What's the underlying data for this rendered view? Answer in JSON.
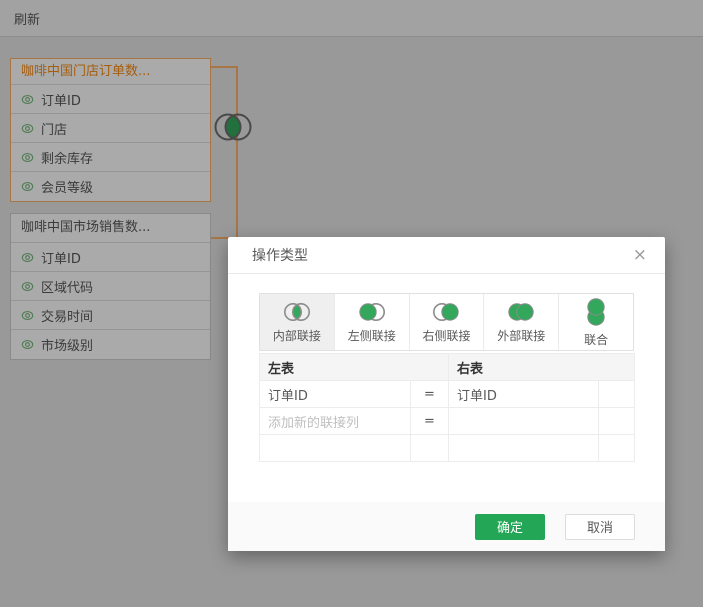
{
  "topbar": {
    "refresh_label": "刷新"
  },
  "canvas": {
    "tables": [
      {
        "name": "咖啡中国门店订单数...",
        "selected": true,
        "fields": [
          "订单ID",
          "门店",
          "剩余库存",
          "会员等级"
        ]
      },
      {
        "name": "咖啡中国市场销售数...",
        "selected": false,
        "fields": [
          "订单ID",
          "区域代码",
          "交易时间",
          "市场级别"
        ]
      }
    ],
    "join_node": "inner-join"
  },
  "dialog": {
    "title": "操作类型",
    "close_icon": "×",
    "join_types": [
      {
        "label": "内部联接",
        "selected": true
      },
      {
        "label": "左侧联接",
        "selected": false
      },
      {
        "label": "右侧联接",
        "selected": false
      },
      {
        "label": "外部联接",
        "selected": false
      },
      {
        "label": "联合",
        "selected": false
      }
    ],
    "mapping": {
      "left_header": "左表",
      "right_header": "右表",
      "rows": [
        {
          "left": "订单ID",
          "op": "=",
          "right": "订单ID"
        },
        {
          "left": "添加新的联接列",
          "op": "=",
          "right": ""
        },
        {
          "left": "",
          "op": "",
          "right": ""
        }
      ]
    },
    "ok_label": "确定",
    "cancel_label": "取消"
  },
  "colors": {
    "accent_green": "#23A757",
    "venn_green": "#33A75B",
    "selection_orange": "#FA8C16",
    "connector_orange": "#F9B168"
  }
}
